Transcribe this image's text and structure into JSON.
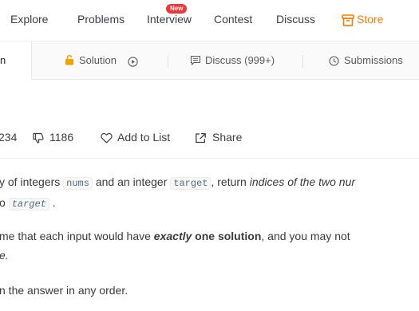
{
  "topnav": {
    "items": [
      {
        "label": "Explore"
      },
      {
        "label": "Problems"
      },
      {
        "label": "Interview"
      },
      {
        "label": "Contest"
      },
      {
        "label": "Discuss"
      },
      {
        "label": "Store"
      }
    ],
    "new_badge": "New",
    "store_color": "#ff7a00"
  },
  "tabs": [
    {
      "label": "n"
    },
    {
      "label": "Solution"
    },
    {
      "label": "Discuss (999+)"
    },
    {
      "label": "Submissions"
    }
  ],
  "stats": {
    "likes_partial": "234",
    "dislikes": "1186",
    "add_to_list": "Add to List",
    "share": "Share"
  },
  "description": {
    "p1": {
      "a": "y of integers ",
      "code1": "nums",
      "b": " and an integer ",
      "code2": "target",
      "c": ", return ",
      "em": "indices of the two nur"
    },
    "p1_line2": {
      "a": "o ",
      "code": "target",
      "b": " ."
    },
    "p2": {
      "a": "me that each input would have ",
      "strong_em": "exactly",
      "strong": " one solution",
      "b": ", and you may not"
    },
    "p2_line2": {
      "em": "e."
    },
    "p3": "n the answer in any order."
  },
  "colors": {
    "accent_orange": "#ff7a00",
    "badge_red": "#f63636",
    "solution_lock": "#f0a300"
  }
}
